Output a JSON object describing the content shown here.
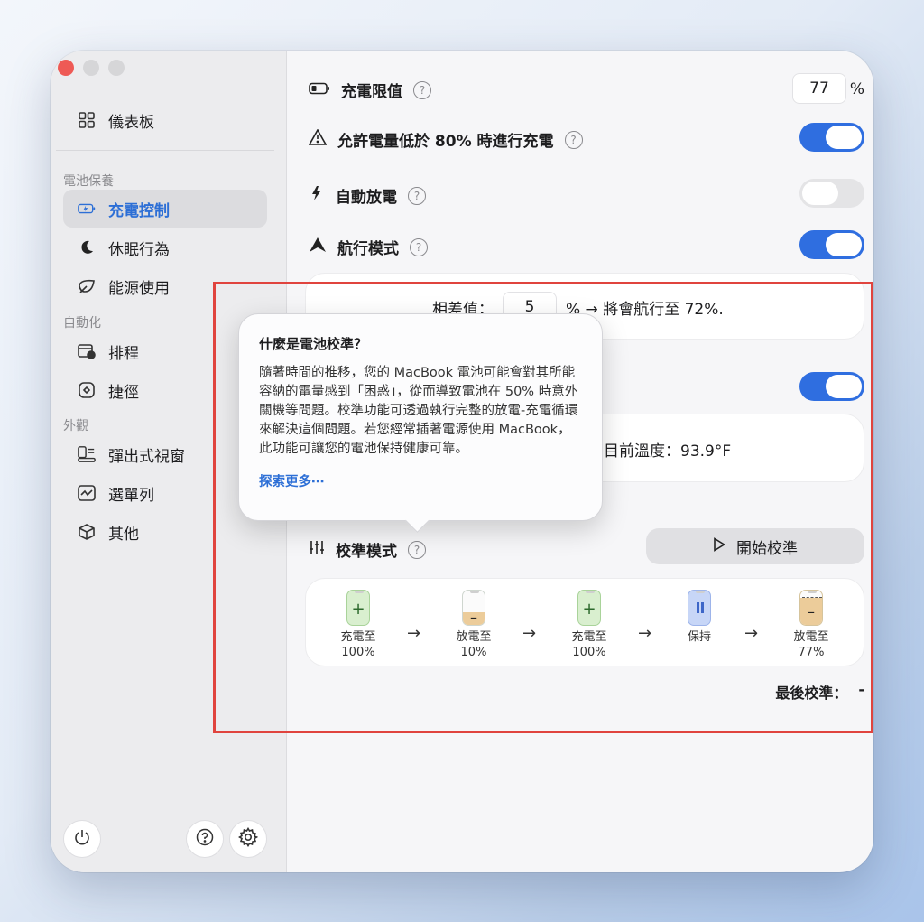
{
  "sidebar": {
    "dashboard": "儀表板",
    "section_battery": "電池保養",
    "charge_control": "充電控制",
    "sleep": "休眠行為",
    "energy": "能源使用",
    "section_automation": "自動化",
    "schedule": "排程",
    "shortcuts": "捷徑",
    "section_appearance": "外觀",
    "popover": "彈出式視窗",
    "menubar": "選單列",
    "other": "其他"
  },
  "main": {
    "charge_limit_label": "充電限值",
    "charge_limit_value": "77",
    "percent": "%",
    "allow_below_label": "允許電量低於 80% 時進行充電",
    "auto_discharge_label": "自動放電",
    "sailing_label": "航行模式",
    "diff_label": "相差值：",
    "diff_value": "5",
    "diff_result": "% → 將會航行至 72%.",
    "temp_text": "目前溫度：93.9°F",
    "calib_label": "校準模式",
    "calib_button": "開始校準",
    "last_calib_label": "最後校準：",
    "last_calib_value": "-"
  },
  "states": {
    "allow_below": true,
    "auto_discharge": false,
    "sailing": true,
    "hidden_row": true
  },
  "steps": [
    {
      "line1": "充電至",
      "line2": "100%",
      "kind": "charge"
    },
    {
      "line1": "放電至",
      "line2": "10%",
      "kind": "discharge"
    },
    {
      "line1": "充電至",
      "line2": "100%",
      "kind": "charge"
    },
    {
      "line1": "保持",
      "line2": "",
      "kind": "hold"
    },
    {
      "line1": "放電至",
      "line2": "77%",
      "kind": "discharge77"
    }
  ],
  "tooltip": {
    "title": "什麼是電池校準？",
    "body": "隨著時間的推移，您的 MacBook 電池可能會對其所能容納的電量感到「困惑」，從而導致電池在 50% 時意外關機等問題。校準功能可透過執行完整的放電-充電循環來解決這個問題。若您經常插著電源使用 MacBook，此功能可讓您的電池保持健康可靠。",
    "link": "探索更多⋯"
  },
  "colors": {
    "accent": "#2f6ee0",
    "highlight": "#e0443e"
  }
}
